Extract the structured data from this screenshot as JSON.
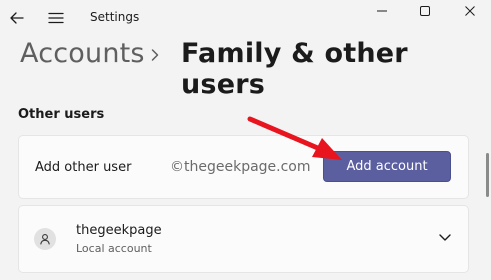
{
  "window": {
    "app_title": "Settings"
  },
  "breadcrumb": {
    "parent": "Accounts",
    "current": "Family & other users"
  },
  "section": {
    "title": "Other users"
  },
  "add_user": {
    "label": "Add other user",
    "watermark": "©thegeekpage.com",
    "button_label": "Add account"
  },
  "user_card": {
    "name": "thegeekpage",
    "account_type": "Local account"
  },
  "colors": {
    "accent": "#5b5fa0",
    "annotation_arrow": "#e8141e"
  }
}
